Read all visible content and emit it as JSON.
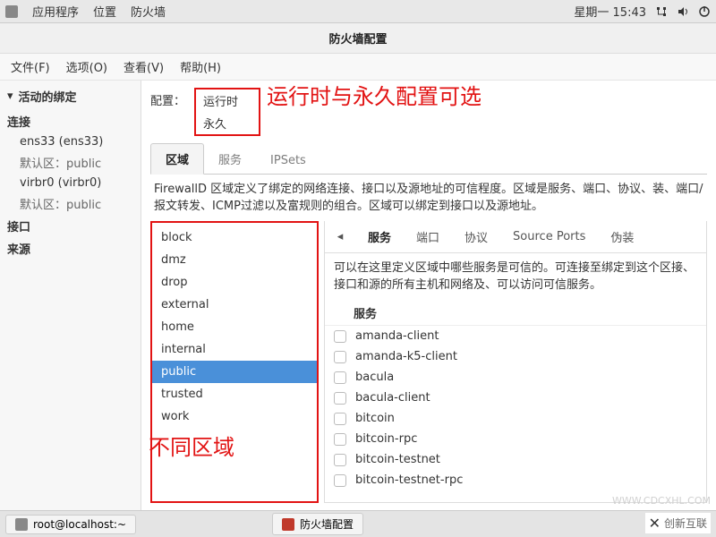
{
  "top_panel": {
    "menus": [
      "应用程序",
      "位置",
      "防火墙"
    ],
    "clock": "星期一  15:43"
  },
  "window": {
    "title": "防火墙配置"
  },
  "menubar": {
    "items": [
      "文件(F)",
      "选项(O)",
      "查看(V)",
      "帮助(H)"
    ]
  },
  "sidebar": {
    "header": "活动的绑定",
    "sections": {
      "connections": {
        "label": "连接",
        "items": [
          {
            "name": "ens33 (ens33)",
            "default": "默认区：public"
          },
          {
            "name": "virbr0 (virbr0)",
            "default": "默认区：public"
          }
        ]
      },
      "interfaces": {
        "label": "接口"
      },
      "sources": {
        "label": "来源"
      }
    }
  },
  "config": {
    "label": "配置：",
    "options": [
      "运行时",
      "永久"
    ]
  },
  "main_tabs": [
    "区域",
    "服务",
    "IPSets"
  ],
  "description": "FirewallD 区域定义了绑定的网络连接、接口以及源地址的可信程度。区域是服务、端口、协议、装、端口/报文转发、ICMP过滤以及富规则的组合。区域可以绑定到接口以及源地址。",
  "zones": [
    "block",
    "dmz",
    "drop",
    "external",
    "home",
    "internal",
    "public",
    "trusted",
    "work"
  ],
  "zone_selected": "public",
  "service_tabs": [
    "服务",
    "端口",
    "协议",
    "Source Ports",
    "伪装"
  ],
  "service_desc": "可以在这里定义区域中哪些服务是可信的。可连接至绑定到这个区接、接口和源的所有主机和网络及、可以访问可信服务。",
  "service_header": "服务",
  "services": [
    "amanda-client",
    "amanda-k5-client",
    "bacula",
    "bacula-client",
    "bitcoin",
    "bitcoin-rpc",
    "bitcoin-testnet",
    "bitcoin-testnet-rpc"
  ],
  "annotations": {
    "config": "运行时与永久配置可选",
    "zones": "不同区域"
  },
  "taskbar": {
    "items": [
      "root@localhost:~",
      "防火墙配置"
    ]
  },
  "watermark": {
    "url": "WWW.CDCXHL.COM",
    "brand": "创新互联"
  }
}
